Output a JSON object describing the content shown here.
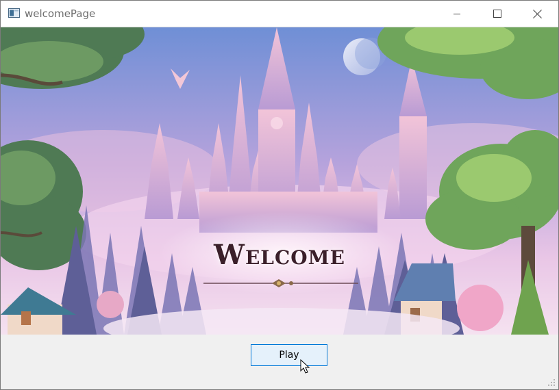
{
  "window": {
    "title": "welcomePage",
    "controls": {
      "minimize": "minimize-icon",
      "maximize": "maximize-icon",
      "close": "close-icon"
    }
  },
  "scene": {
    "heading": "Welcome",
    "colors": {
      "sky_top": "#6f8fd6",
      "sky_mid": "#b7a3dc",
      "mist": "#f3d8ee",
      "castle": "#e7b7d3"
    }
  },
  "actions": {
    "play_label": "Play"
  },
  "colors": {
    "button_border": "#0078d7",
    "button_fill": "#e5f1fb",
    "title_text": "#6d6d6d"
  }
}
